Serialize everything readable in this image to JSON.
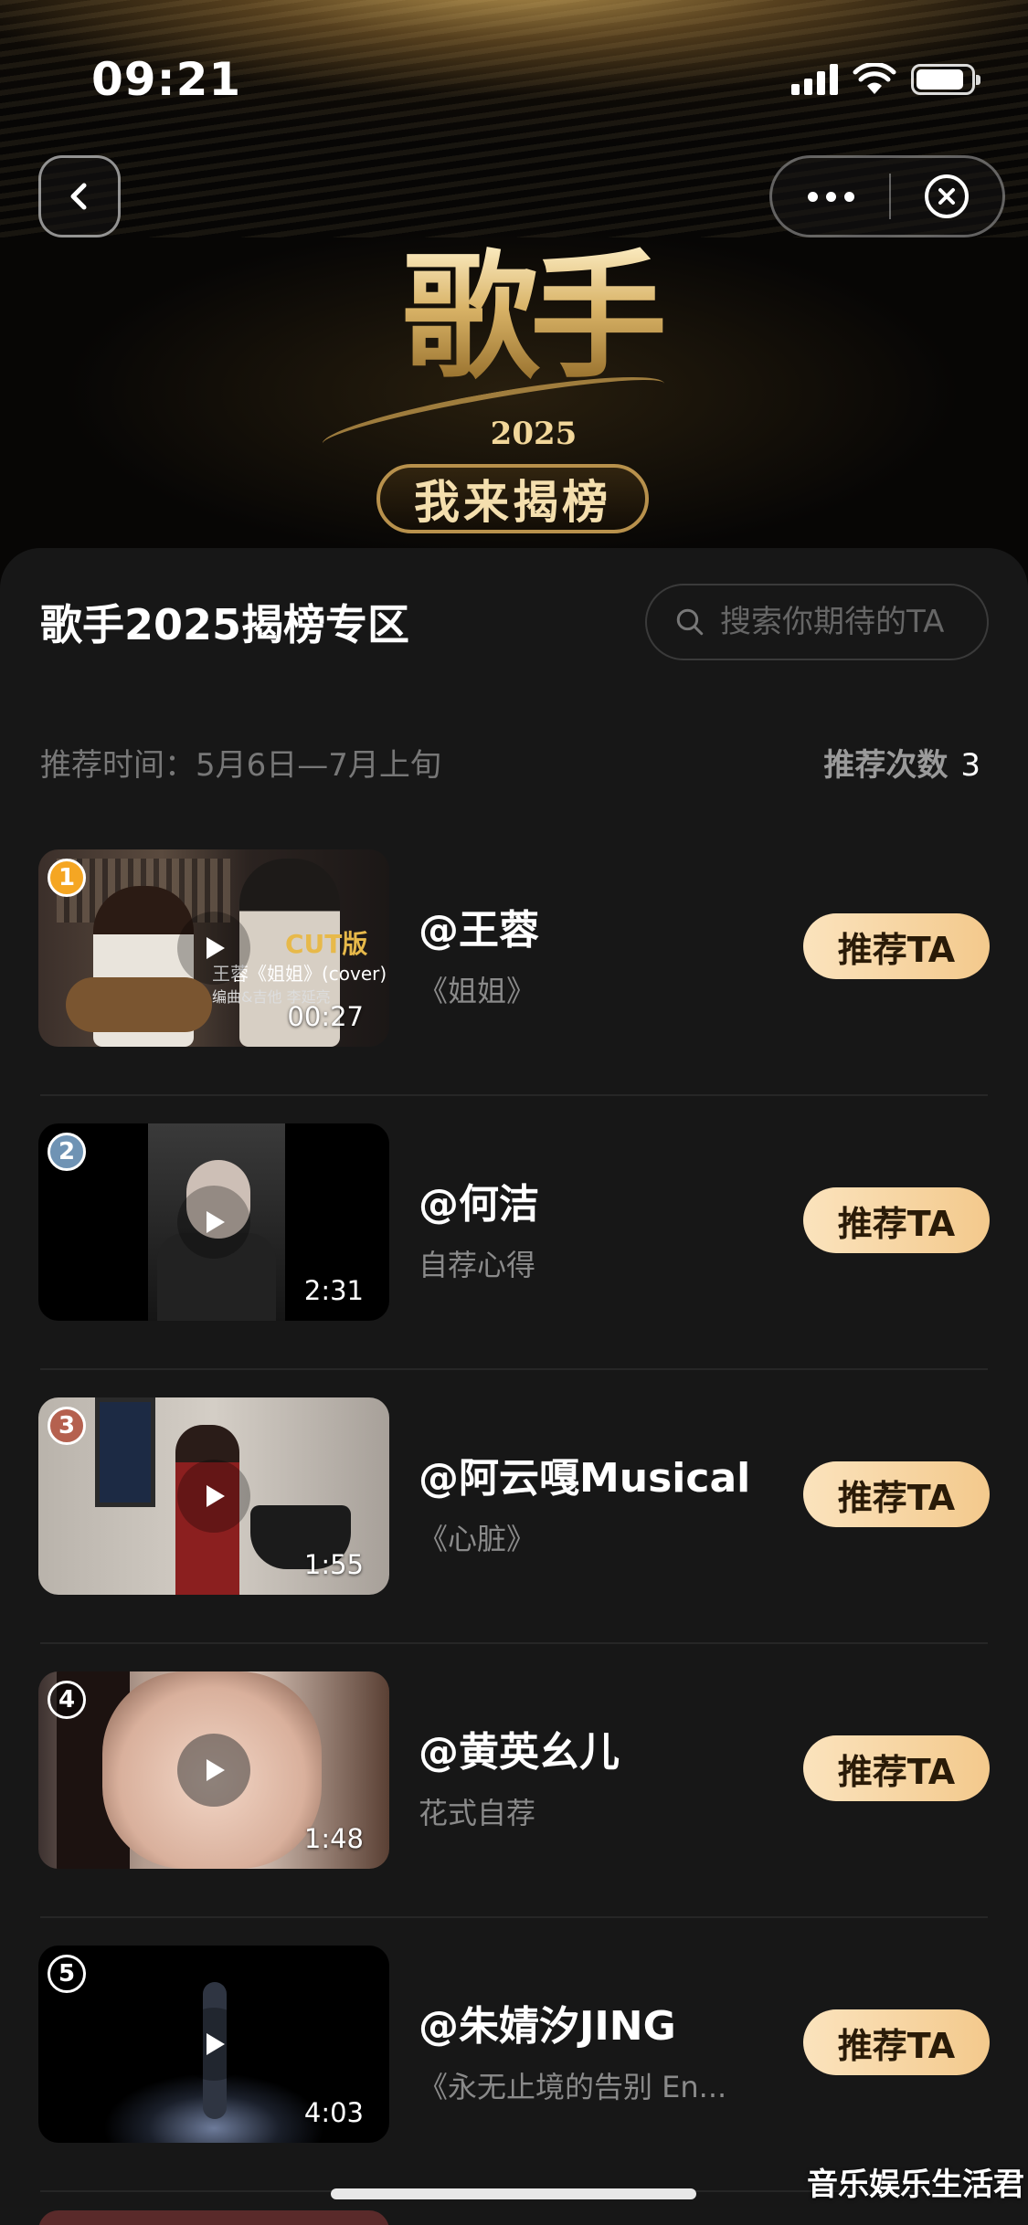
{
  "status_bar": {
    "time": "09:21"
  },
  "banner": {
    "logo_text": "歌手",
    "logo_year": "2025",
    "logo_subtitle": "我来揭榜"
  },
  "section": {
    "title": "歌手2025揭榜专区",
    "search_placeholder": "搜索你期待的TA",
    "time_label": "推荐时间：5月6日—7月上旬",
    "count_label": "推荐次数",
    "count_value": "3"
  },
  "colors": {
    "rank_1": "#f5a623",
    "rank_2": "#6f93b4",
    "rank_3": "#b5614f",
    "button_start": "#fbe3bd",
    "button_end": "#f3c98c"
  },
  "candidates": [
    {
      "rank": "1",
      "name": "@王蓉",
      "subtitle": "《姐姐》",
      "duration": "00:27",
      "button": "推荐TA",
      "thumb_overlay": {
        "badge": "CUT版",
        "caption": "王蓉《姐姐》(cover)",
        "credit": "编曲&吉他 李延亮"
      }
    },
    {
      "rank": "2",
      "name": "@何洁",
      "subtitle": "自荐心得",
      "duration": "2:31",
      "button": "推荐TA"
    },
    {
      "rank": "3",
      "name": "@阿云嘎Musical",
      "subtitle": "《心脏》",
      "duration": "1:55",
      "button": "推荐TA"
    },
    {
      "rank": "4",
      "name": "@黄英幺儿",
      "subtitle": "花式自荐",
      "duration": "1:48",
      "button": "推荐TA"
    },
    {
      "rank": "5",
      "name": "@朱婧汐JING",
      "subtitle": "《永无止境的告别 En...",
      "duration": "4:03",
      "button": "推荐TA"
    }
  ],
  "watermark": "音乐娱乐生活君"
}
